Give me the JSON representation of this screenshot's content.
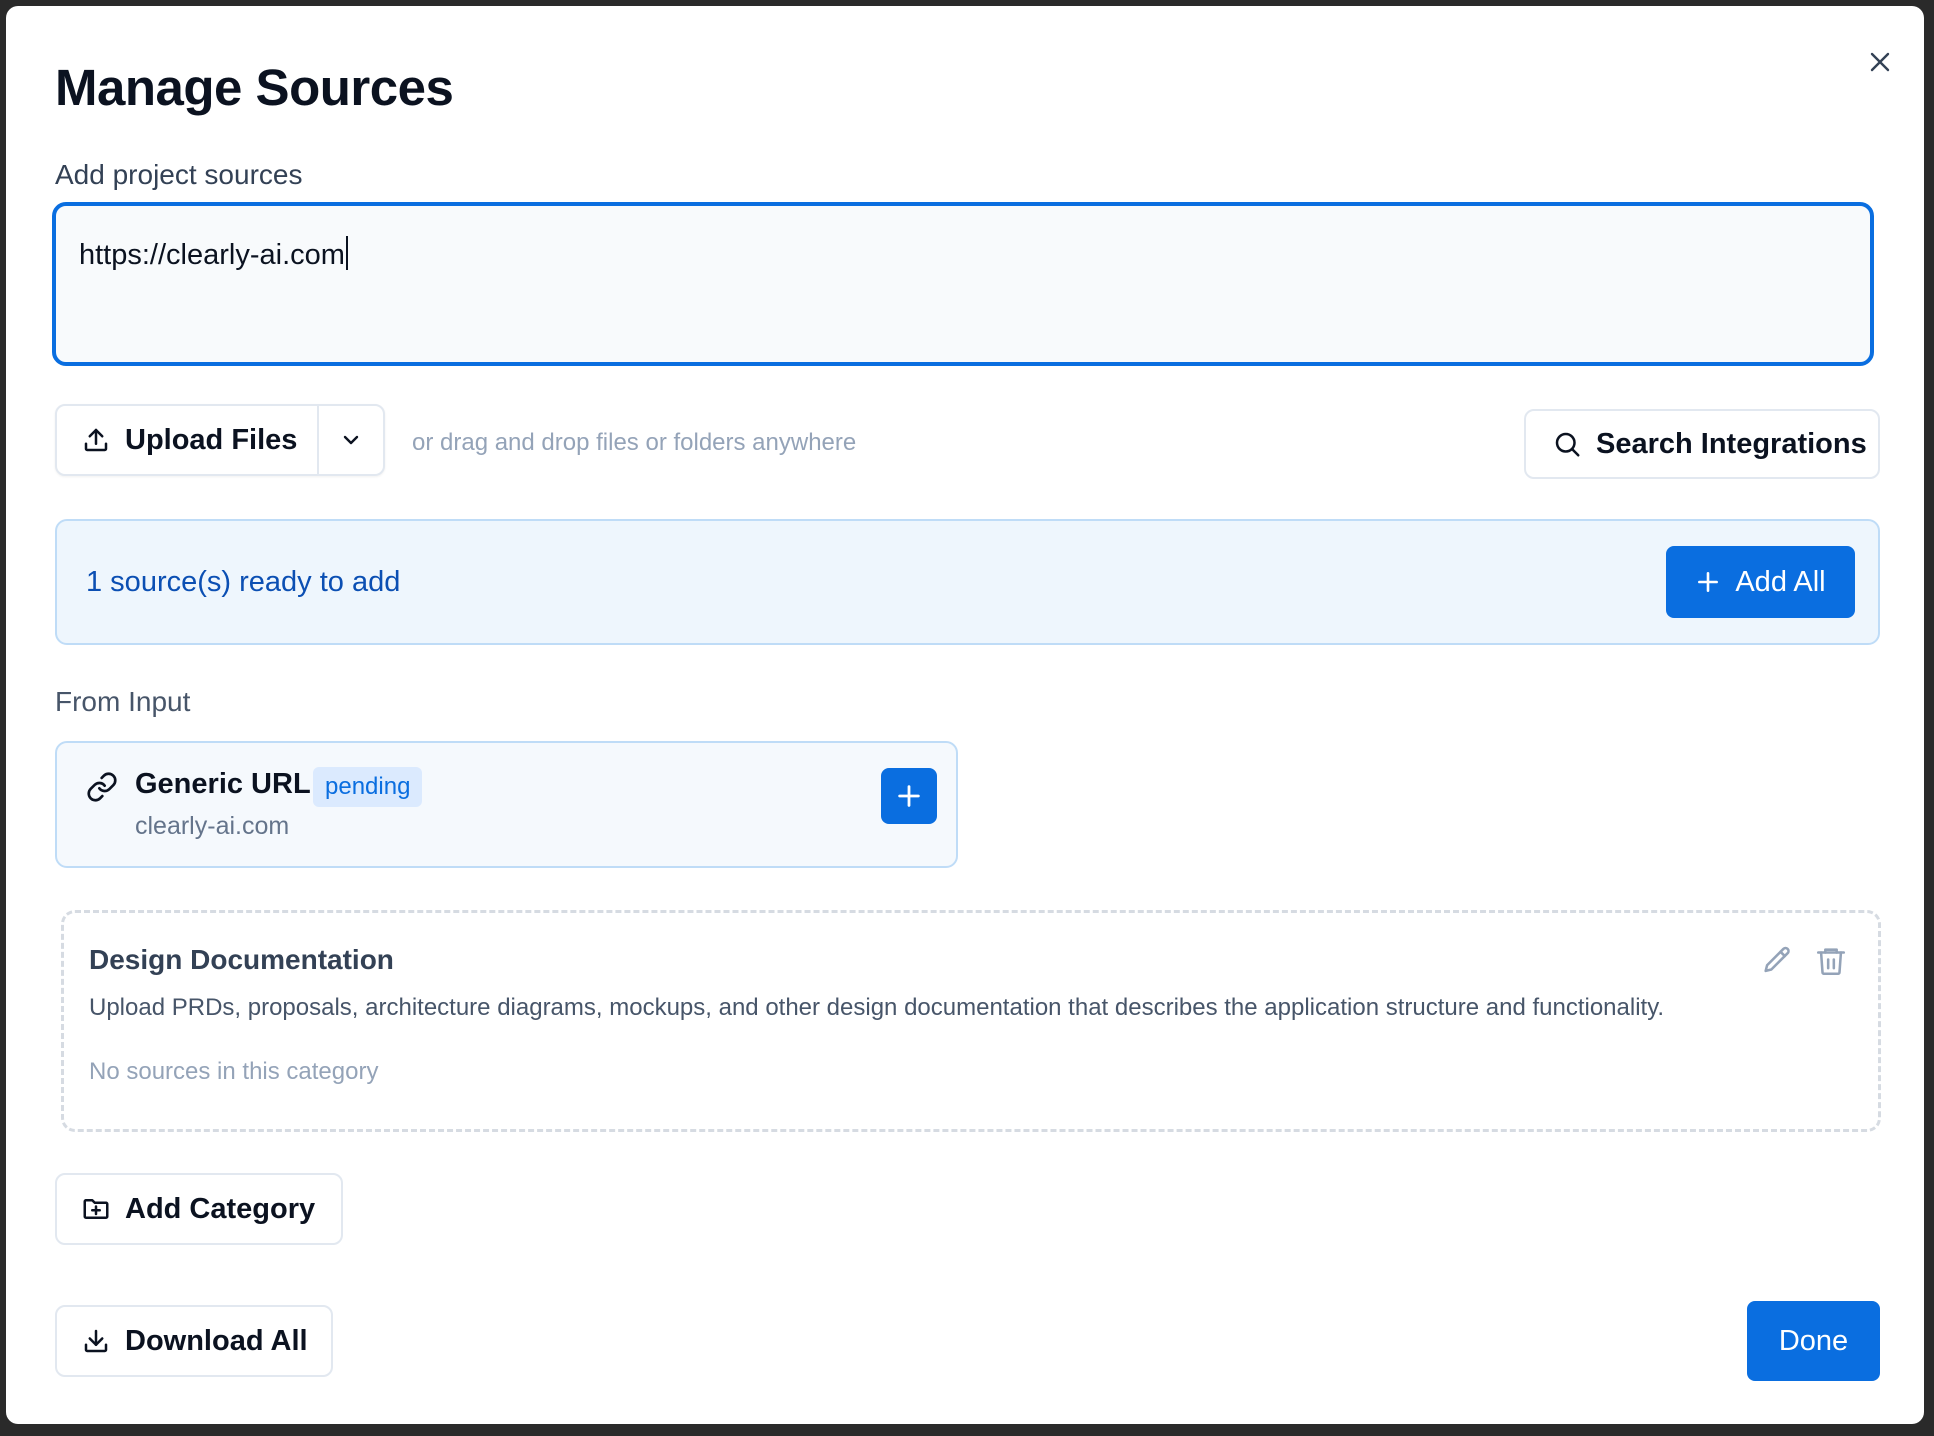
{
  "dialog": {
    "title": "Manage Sources",
    "close_icon": "close-icon"
  },
  "sources_input": {
    "label": "Add project sources",
    "value": "https://clearly-ai.com"
  },
  "toolbar": {
    "upload_label": "Upload Files",
    "drag_hint": "or drag and drop files or folders anywhere",
    "search_integrations_label": "Search Integrations"
  },
  "ready_banner": {
    "text": "1 source(s) ready to add",
    "add_all_label": "Add All"
  },
  "from_input": {
    "heading": "From Input",
    "items": [
      {
        "type": "Generic URL",
        "status": "pending",
        "value": "clearly-ai.com"
      }
    ]
  },
  "categories": [
    {
      "title": "Design Documentation",
      "description": "Upload PRDs, proposals, architecture diagrams, mockups, and other design documentation that describes the application structure and functionality.",
      "empty_text": "No sources in this category"
    }
  ],
  "footer": {
    "add_category_label": "Add Category",
    "download_all_label": "Download All",
    "done_label": "Done"
  },
  "colors": {
    "accent": "#0a6ee0",
    "banner_bg": "#eef6fd",
    "banner_text": "#0b4fb3"
  }
}
